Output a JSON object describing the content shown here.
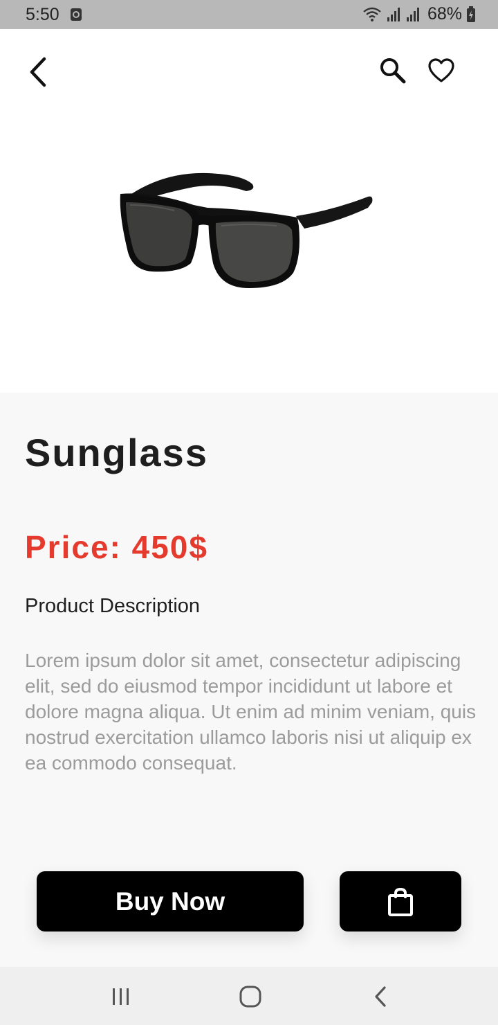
{
  "status_bar": {
    "time": "5:50",
    "battery": "68%"
  },
  "app_bar": {
    "back_icon": "arrow-back-icon",
    "search_icon": "search-icon",
    "favorite_icon": "heart-outline-icon"
  },
  "product": {
    "name": "Sunglass",
    "price": "Price: 450$",
    "description_heading": "Product Description",
    "description": "Lorem ipsum dolor sit amet, consectetur adipiscing elit, sed do eiusmod tempor incididunt ut labore et dolore magna aliqua. Ut enim ad minim veniam, quis nostrud exercitation ullamco laboris nisi ut aliquip ex ea commodo consequat."
  },
  "actions": {
    "buy_label": "Buy Now",
    "cart_icon": "shopping-bag-icon"
  },
  "colors": {
    "price": "#e53b2f",
    "button": "#000000",
    "details_bg": "#f8f8f8"
  }
}
